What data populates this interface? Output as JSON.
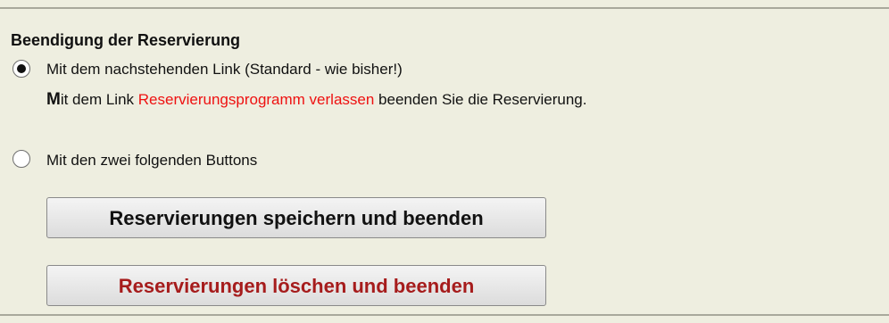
{
  "section": {
    "title": "Beendigung der Reservierung"
  },
  "options": {
    "link_option": {
      "label": "Mit dem nachstehenden Link (Standard - wie bisher!)",
      "selected": true
    },
    "buttons_option": {
      "label": "Mit den zwei folgenden Buttons",
      "selected": false
    }
  },
  "description": {
    "first_letter": "M",
    "text_before": "it dem Link ",
    "link_text": "Reservierungsprogramm verlassen",
    "text_after": " beenden Sie die Reservierung."
  },
  "buttons": {
    "save_label": "Reservierungen speichern und beenden",
    "delete_label": "Reservierungen löschen und beenden"
  },
  "colors": {
    "background": "#eeeee0",
    "link_red": "#ee1111",
    "delete_text": "#a61c1c"
  }
}
